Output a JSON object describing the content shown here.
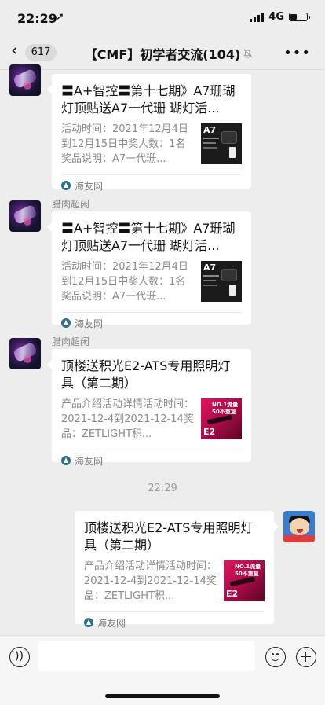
{
  "status": {
    "time": "22:29",
    "location_icon": "location-arrow-icon",
    "network": "4G"
  },
  "nav": {
    "back_icon": "chevron-left-icon",
    "unread_count": "617",
    "title": "【CMF】初学者交流(104)",
    "mute_icon": "bell-slash-icon",
    "more_icon": "ellipsis-icon"
  },
  "messages": [
    {
      "sender": "",
      "title": "〓A+智控〓第十七期》A7珊瑚灯顶贴送A7一代珊 瑚灯活...",
      "desc": "活动时间：2021年12月4日到12月15日中奖人数：1名奖品说明：A7一代珊...",
      "source": "海友网",
      "thumb_label": "A7"
    },
    {
      "sender": "腊肉超闲",
      "title": "〓A+智控〓第十七期》A7珊瑚灯顶贴送A7一代珊 瑚灯活...",
      "desc": "活动时间：2021年12月4日到12月15日中奖人数：1名奖品说明：A7一代珊...",
      "source": "海友网",
      "thumb_label": "A7"
    },
    {
      "sender": "腊肉超闲",
      "title": "顶楼送积光E2-ATS专用照明灯具（第二期）",
      "desc": "产品介绍活动详情活动时间：2021-12-4到2021-12-14奖品：ZETLIGHT积...",
      "source": "海友网",
      "thumb_lines": [
        "NO.1流量",
        "50不重复"
      ],
      "thumb_label": "E2"
    }
  ],
  "timestamp": "22:29",
  "my_message": {
    "title": "顶楼送积光E2-ATS专用照明灯具（第二期）",
    "desc": "产品介绍活动详情活动时间：2021-12-4到2021-12-14奖品：ZETLIGHT积...",
    "source": "海友网",
    "thumb_lines": [
      "NO.1流量",
      "50不重复"
    ],
    "thumb_label": "E2"
  },
  "input": {
    "placeholder": "",
    "voice_icon": "voice-icon",
    "emoji_icon": "emoji-icon",
    "plus_icon": "plus-icon"
  }
}
